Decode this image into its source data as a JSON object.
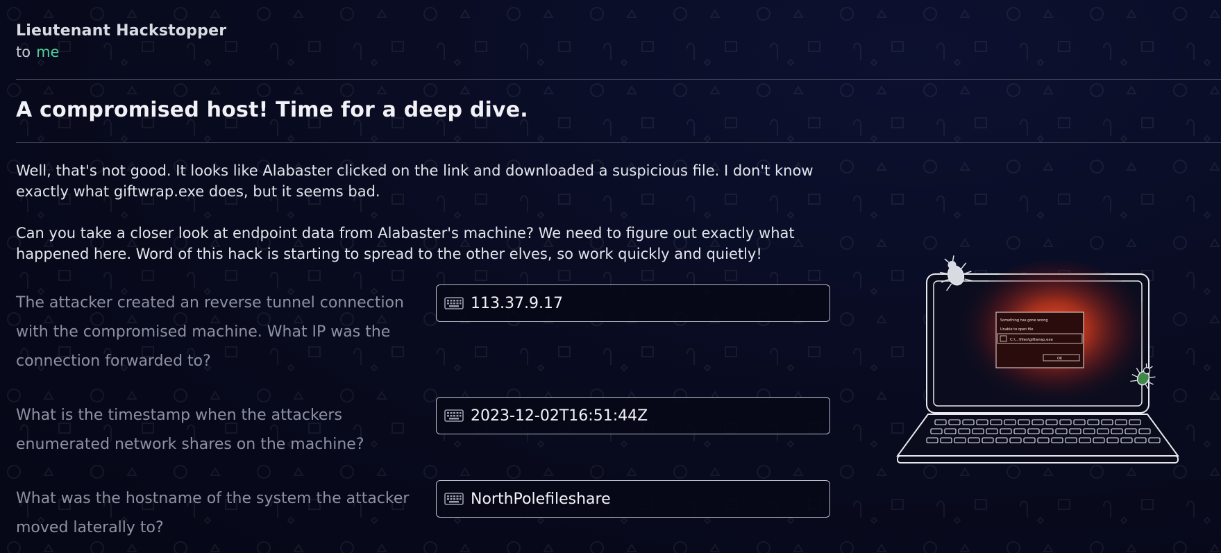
{
  "message": {
    "sender": "Lieutenant Hackstopper",
    "to_label": "to",
    "recipient": "me",
    "subject": "A compromised host! Time for a deep dive.",
    "paragraphs": [
      "Well, that's not good. It looks like Alabaster clicked on the link and downloaded a suspicious file. I don't know exactly what giftwrap.exe does, but it seems bad.",
      "Can you take a closer look at endpoint data from Alabaster's machine? We need to figure out exactly what happened here. Word of this hack is starting to spread to the other elves, so work quickly and quietly!"
    ]
  },
  "questions": [
    {
      "text": "The attacker created an reverse tunnel connection with the compromised machine. What IP was the connection forwarded to?",
      "answer": "113.37.9.17",
      "icon": "keyboard-icon"
    },
    {
      "text": "What is the timestamp when the attackers enumerated network shares on the machine?",
      "answer": "2023-12-02T16:51:44Z",
      "icon": "keyboard-icon"
    },
    {
      "text": "What was the hostname of the system the attacker moved laterally to?",
      "answer": "NorthPolefileshare",
      "icon": "keyboard-icon"
    }
  ],
  "illustration": {
    "dialog_title": "Something has gone wrong",
    "dialog_subtitle": "Unable to open file",
    "dialog_path": "C:\\...\\files\\giftwrap.exe",
    "dialog_button": "OK",
    "colors": {
      "glow": "#e0401e",
      "bug_dark": "#d9dbe3",
      "bug_green": "#3f8a4a"
    }
  },
  "colors": {
    "background": "#080a1e",
    "accent_green": "#4fd1a0",
    "question_text": "#8d91a1",
    "input_border": "#b9bccb"
  }
}
